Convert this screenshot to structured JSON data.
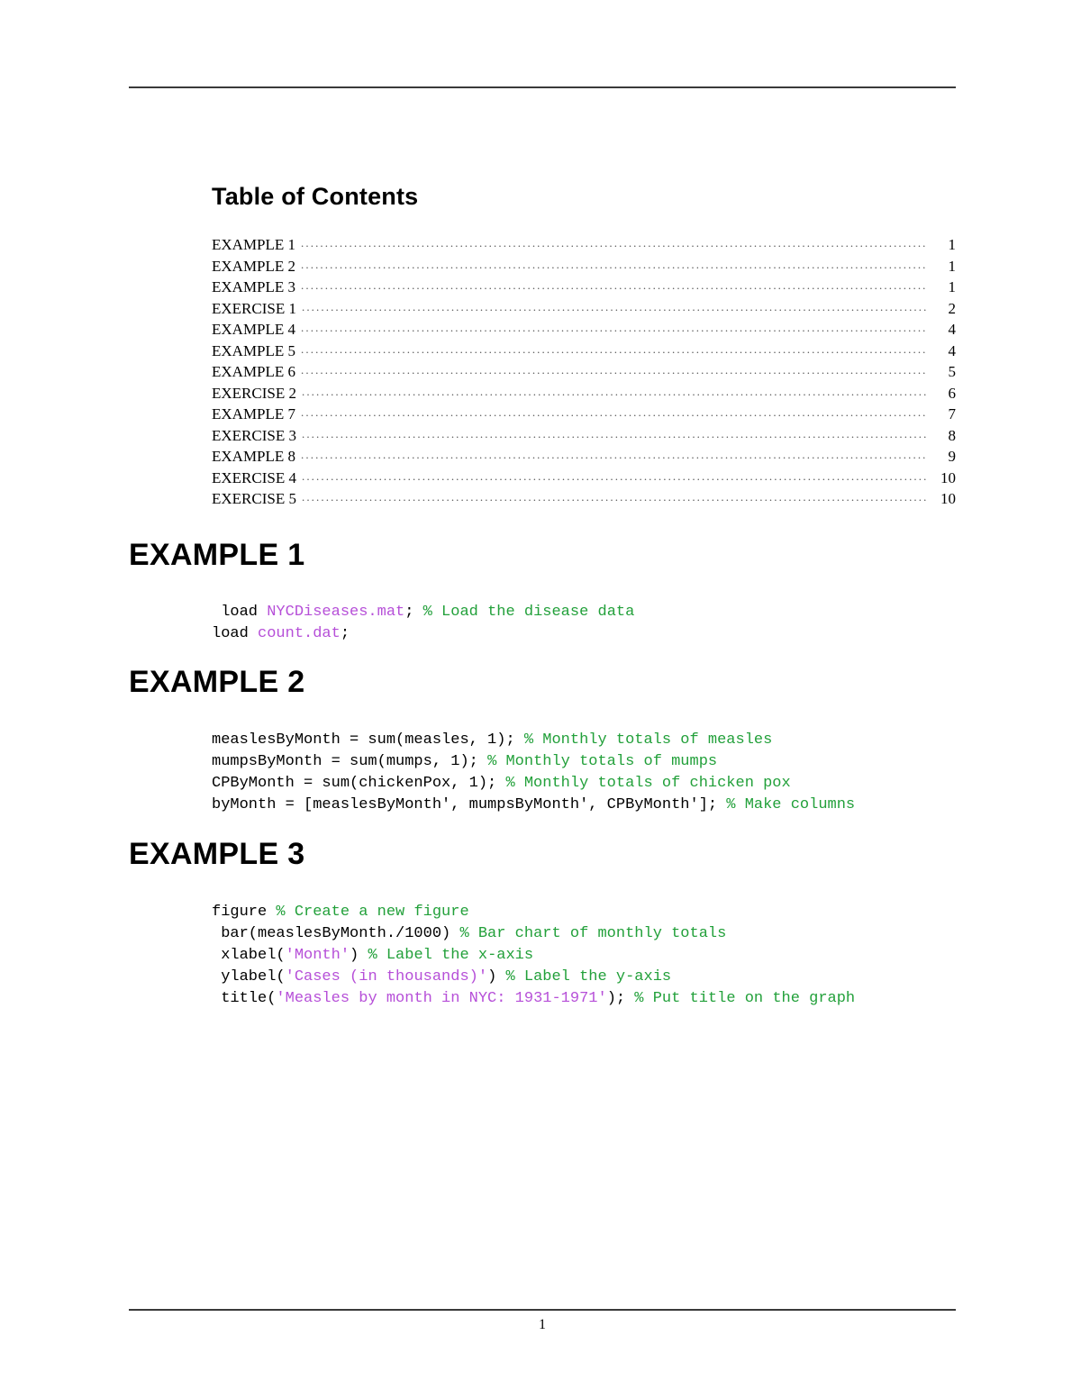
{
  "document": {
    "page_number": "1",
    "toc_title": "Table of Contents"
  },
  "colors": {
    "text": "#000000",
    "string": "#b64fd8",
    "comment": "#22a03a",
    "rule": "#3a3a3a"
  },
  "toc": {
    "leader": "..............................................................................................................................................................",
    "entries": [
      {
        "label": "EXAMPLE 1",
        "page": "1"
      },
      {
        "label": "EXAMPLE 2",
        "page": "1"
      },
      {
        "label": "EXAMPLE 3",
        "page": "1"
      },
      {
        "label": "EXERCISE 1",
        "page": "2"
      },
      {
        "label": "EXAMPLE 4",
        "page": "4"
      },
      {
        "label": "EXAMPLE 5",
        "page": "4"
      },
      {
        "label": "EXAMPLE 6",
        "page": "5"
      },
      {
        "label": "EXERCISE 2",
        "page": "6"
      },
      {
        "label": "EXAMPLE 7",
        "page": "7"
      },
      {
        "label": "EXERCISE 3",
        "page": "8"
      },
      {
        "label": "EXAMPLE 8",
        "page": "9"
      },
      {
        "label": "EXERCISE 4",
        "page": "10"
      },
      {
        "label": "EXERCISE 5",
        "page": "10"
      }
    ]
  },
  "sections": [
    {
      "heading": "EXAMPLE 1",
      "code": [
        [
          {
            "t": "plain",
            "s": " load "
          },
          {
            "t": "string",
            "s": "NYCDiseases.mat"
          },
          {
            "t": "plain",
            "s": "; "
          },
          {
            "t": "comment",
            "s": "% Load the disease data"
          }
        ],
        [
          {
            "t": "plain",
            "s": "load "
          },
          {
            "t": "string",
            "s": "count.dat"
          },
          {
            "t": "plain",
            "s": ";"
          }
        ]
      ]
    },
    {
      "heading": "EXAMPLE 2",
      "code": [
        [
          {
            "t": "plain",
            "s": "measlesByMonth = sum(measles, 1); "
          },
          {
            "t": "comment",
            "s": "% Monthly totals of measles"
          }
        ],
        [
          {
            "t": "plain",
            "s": "mumpsByMonth = sum(mumps, 1); "
          },
          {
            "t": "comment",
            "s": "% Monthly totals of mumps"
          }
        ],
        [
          {
            "t": "plain",
            "s": "CPByMonth = sum(chickenPox, 1); "
          },
          {
            "t": "comment",
            "s": "% Monthly totals of chicken pox"
          }
        ],
        [
          {
            "t": "plain",
            "s": "byMonth = [measlesByMonth', mumpsByMonth', CPByMonth']; "
          },
          {
            "t": "comment",
            "s": "% Make columns"
          }
        ]
      ]
    },
    {
      "heading": "EXAMPLE 3",
      "code": [
        [
          {
            "t": "plain",
            "s": "figure "
          },
          {
            "t": "comment",
            "s": "% Create a new figure"
          }
        ],
        [
          {
            "t": "plain",
            "s": " bar(measlesByMonth./1000) "
          },
          {
            "t": "comment",
            "s": "% Bar chart of monthly totals"
          }
        ],
        [
          {
            "t": "plain",
            "s": " xlabel("
          },
          {
            "t": "string",
            "s": "'Month'"
          },
          {
            "t": "plain",
            "s": ") "
          },
          {
            "t": "comment",
            "s": "% Label the x-axis"
          }
        ],
        [
          {
            "t": "plain",
            "s": " ylabel("
          },
          {
            "t": "string",
            "s": "'Cases (in thousands)'"
          },
          {
            "t": "plain",
            "s": ") "
          },
          {
            "t": "comment",
            "s": "% Label the y-axis"
          }
        ],
        [
          {
            "t": "plain",
            "s": " title("
          },
          {
            "t": "string",
            "s": "'Measles by month in NYC: 1931-1971'"
          },
          {
            "t": "plain",
            "s": "); "
          },
          {
            "t": "comment",
            "s": "% Put title on the graph"
          }
        ]
      ]
    }
  ]
}
